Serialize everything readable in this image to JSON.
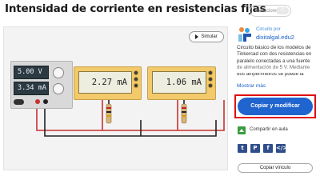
{
  "page": {
    "title": "Intensidad de corriente en resistencias fijas",
    "reactions_label": "Reacciones",
    "reactions_count": "0"
  },
  "canvas": {
    "simulate_label": "Simular",
    "psu": {
      "voltage": "5.00 V",
      "current": "3.34 mA"
    },
    "meters": [
      {
        "reading": "2.27 mA"
      },
      {
        "reading": "1.06 mA"
      }
    ]
  },
  "sidebar": {
    "author_caption": "Circuito por",
    "author_name": "dixitalgal.edu2",
    "description": "Circuito básico de los modelos de Tinkercad con dos resistencias en paralelo conectadas a una fuente de alimentación de 5 V. Mediante dos amperímetros se puede la",
    "show_more": "Mostrar más",
    "copy_button": "Copiar y modificar",
    "share_label": "Compartir en aula",
    "social": [
      {
        "icon": "twitter-icon",
        "glyph": "t"
      },
      {
        "icon": "pinterest-icon",
        "glyph": "P"
      },
      {
        "icon": "facebook-icon",
        "glyph": "f"
      },
      {
        "icon": "embed-icon",
        "glyph": "</>"
      }
    ],
    "copy_link": "Copiar vínculo"
  },
  "colors": {
    "accent": "#1f64cf",
    "highlight": "#e01010",
    "meter_body": "#f2c96b",
    "psu_display": "#2b3b41",
    "wire_red": "#c83232",
    "wire_black": "#222222"
  }
}
